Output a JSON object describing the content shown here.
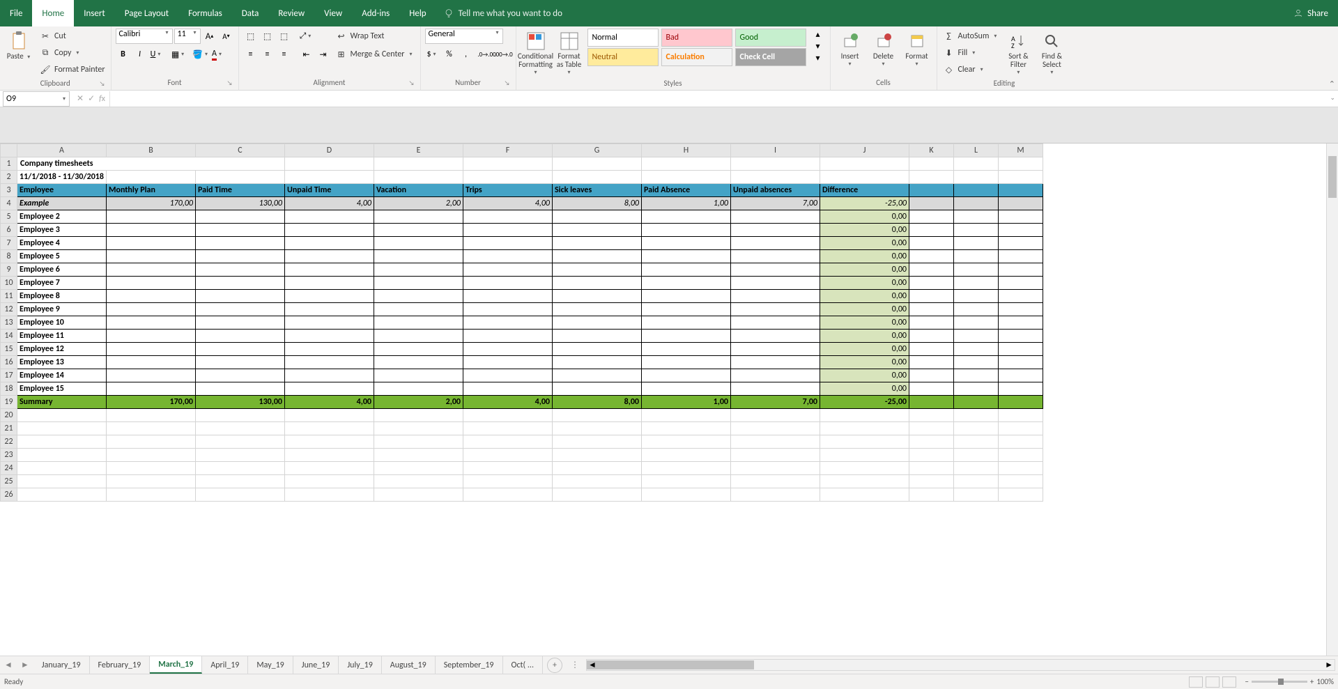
{
  "menu": {
    "tabs": [
      "File",
      "Home",
      "Insert",
      "Page Layout",
      "Formulas",
      "Data",
      "Review",
      "View",
      "Add-ins",
      "Help"
    ],
    "active": 1,
    "tell": "Tell me what you want to do",
    "share": "Share"
  },
  "ribbon": {
    "clipboard": {
      "title": "Clipboard",
      "paste": "Paste",
      "cut": "Cut",
      "copy": "Copy",
      "painter": "Format Painter"
    },
    "font": {
      "title": "Font",
      "name": "Calibri",
      "size": "11"
    },
    "alignment": {
      "title": "Alignment",
      "wrap": "Wrap Text",
      "merge": "Merge & Center"
    },
    "number": {
      "title": "Number",
      "format": "General"
    },
    "styles": {
      "title": "Styles",
      "cond": "Conditional Formatting",
      "table": "Format as Table",
      "s": [
        "Normal",
        "Bad",
        "Good",
        "Neutral",
        "Calculation",
        "Check Cell"
      ]
    },
    "cells": {
      "title": "Cells",
      "insert": "Insert",
      "delete": "Delete",
      "format": "Format"
    },
    "editing": {
      "title": "Editing",
      "autosum": "AutoSum",
      "fill": "Fill",
      "clear": "Clear",
      "sort": "Sort & Filter",
      "find": "Find & Select"
    }
  },
  "fx": {
    "namebox": "O9",
    "formula": ""
  },
  "sheet": {
    "cols": [
      "A",
      "B",
      "C",
      "D",
      "E",
      "F",
      "G",
      "H",
      "I",
      "J",
      "K",
      "L",
      "M"
    ],
    "title": "Company timesheets",
    "range": "11/1/2018 - 11/30/2018",
    "headers": [
      "Employee",
      "Monthly Plan",
      "Paid Time",
      "Unpaid Time",
      "Vacation",
      "Trips",
      "Sick leaves",
      "Paid Absence",
      "Unpaid absences",
      "Difference"
    ],
    "example": {
      "label": "Example",
      "vals": [
        "170,00",
        "130,00",
        "4,00",
        "2,00",
        "4,00",
        "8,00",
        "1,00",
        "7,00",
        "-25,00"
      ]
    },
    "employees": [
      "Employee 2",
      "Employee 3",
      "Employee 4",
      "Employee 5",
      "Employee 6",
      "Employee 7",
      "Employee 8",
      "Employee 9",
      "Employee 10",
      "Employee 11",
      "Employee 12",
      "Employee 13",
      "Employee 14",
      "Employee 15"
    ],
    "empDiff": "0,00",
    "summary": {
      "label": "Summary",
      "vals": [
        "170,00",
        "130,00",
        "4,00",
        "2,00",
        "4,00",
        "8,00",
        "1,00",
        "7,00",
        "-25,00"
      ]
    }
  },
  "tabs": {
    "list": [
      "January_19",
      "February_19",
      "March_19",
      "April_19",
      "May_19",
      "June_19",
      "July_19",
      "August_19",
      "September_19",
      "Oct( ..."
    ],
    "active": 2
  },
  "status": {
    "ready": "Ready",
    "zoom": "100%"
  }
}
